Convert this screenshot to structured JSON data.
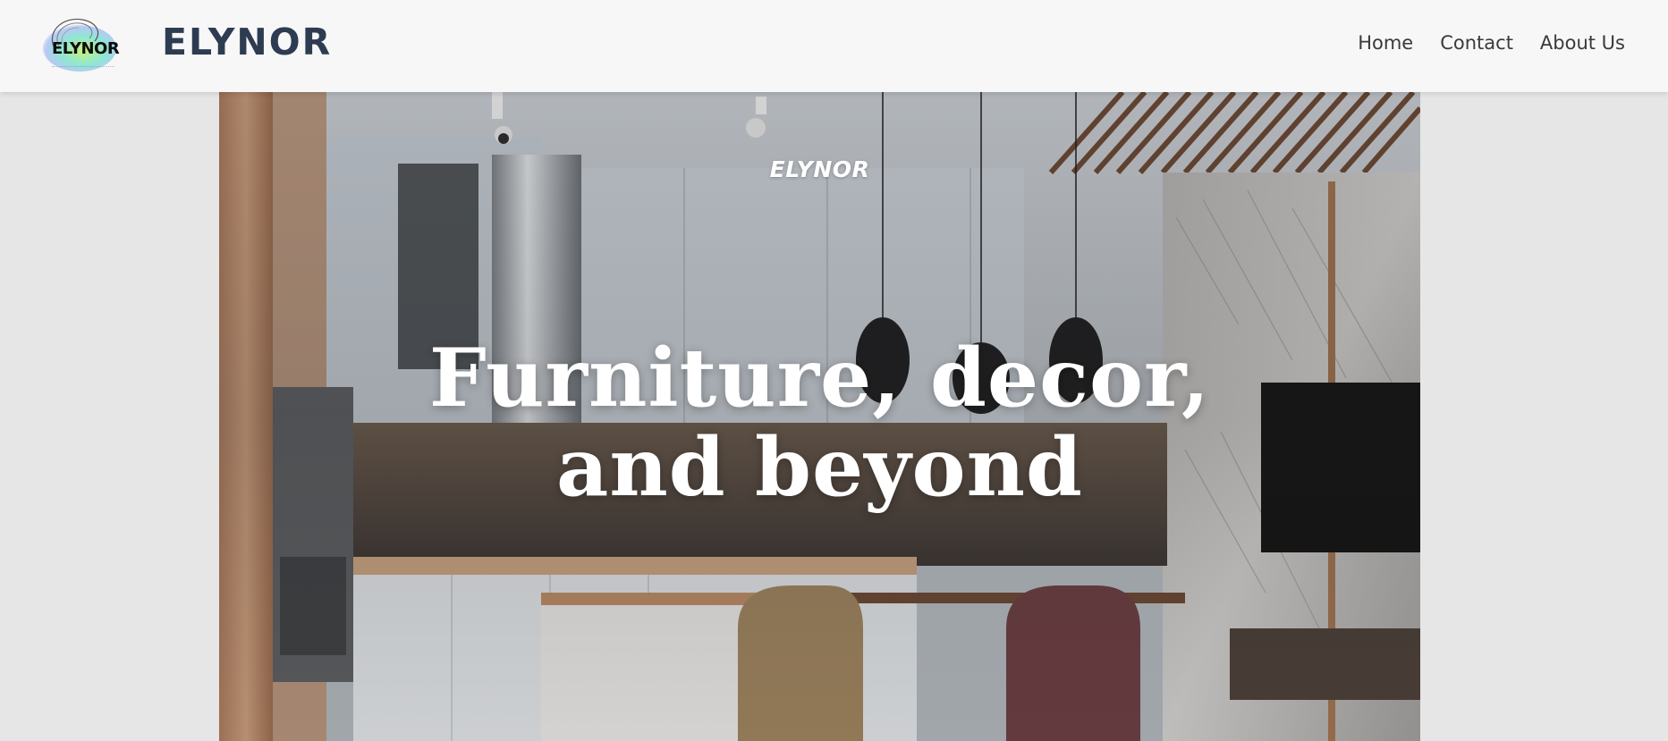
{
  "header": {
    "logo_text": "ELYNOR",
    "brand": "ELYNOR",
    "nav": [
      {
        "label": "Home"
      },
      {
        "label": "Contact"
      },
      {
        "label": "About Us"
      }
    ]
  },
  "hero": {
    "brand": "ELYNOR",
    "title_line1": "Furniture, decor,",
    "title_line2": "and beyond"
  },
  "colors": {
    "header_bg": "#f7f7f7",
    "page_bg": "#e6e6e6",
    "brand_text": "#2e3c52",
    "nav_text": "#3a3a3a",
    "hero_text": "#ffffff"
  }
}
